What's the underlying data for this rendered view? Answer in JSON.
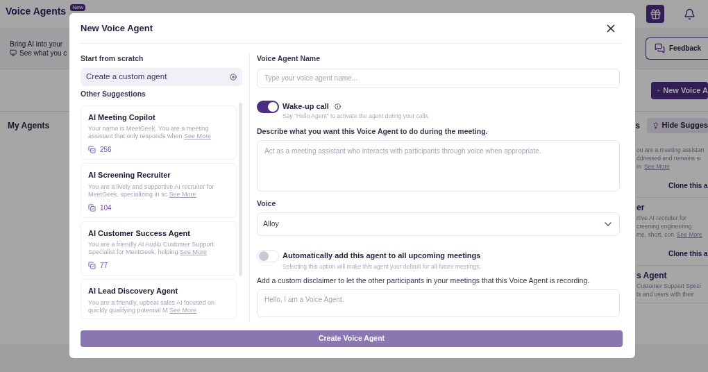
{
  "page": {
    "title": "Voice Agents",
    "badge": "New",
    "banner_lines": [
      "Bring AI into your",
      "See what you c"
    ],
    "feedback": "Feedback",
    "new_button": "New Voice A",
    "section_title": "My Agents",
    "section_tail": "s",
    "hide_button": "Hide Sugges",
    "cards": [
      {
        "lines": [
          "ou are a meeting assistan",
          "ddressed and remains si",
          "m"
        ],
        "see_more": "See More",
        "action": "Clone this a"
      },
      {
        "title": "er",
        "lines": [
          "rtive AI recruiter for",
          "creening engineering",
          "me, short, con"
        ],
        "see_more": "See More",
        "action": "Clone this a"
      },
      {
        "title": "s Agent",
        "lines": [
          "Customer Support Speci",
          "ts and users with their"
        ]
      }
    ]
  },
  "modal": {
    "title": "New Voice Agent",
    "scratch_label": "Start from scratch",
    "custom_button": "Create a custom agent",
    "suggestions_label": "Other Suggestions",
    "suggestions": [
      {
        "title": "AI Meeting Copilot",
        "description": "Your name is MeetGeek. You are a meeting assistant that only responds when",
        "see_more": "See More",
        "count": "256"
      },
      {
        "title": "AI Screening Recruiter",
        "description": "You are a lively and supportive AI recruiter for MeetGeek, specializing in sc",
        "see_more": "See More",
        "count": "104"
      },
      {
        "title": "AI Customer Success Agent",
        "description": "You are a friendly AI Audio Customer Support Specialist for MeetGeek, helping",
        "see_more": "See More",
        "count": "77"
      },
      {
        "title": "AI Lead Discovery Agent",
        "description": "You are a friendly, upbeat sales AI focused on quickly qualifying potential M",
        "see_more": "See More"
      }
    ],
    "name_label": "Voice Agent Name",
    "name_placeholder": "Type your voice agent name...",
    "wake": {
      "label": "Wake-up call",
      "hint": "Say \"Hello Agent\" to activate the agent during your calls.",
      "on": true
    },
    "describe_label": "Describe what you want this Voice Agent to do during the meeting.",
    "describe_placeholder": "Act as a meeting assistant who interacts with participants through voice when appropriate.",
    "voice_label": "Voice",
    "voice_value": "Alloy",
    "auto": {
      "label": "Automatically add this agent to all upcoming meetings",
      "hint": "Selecting this option will make this agent your default for all future meetings.",
      "on": false
    },
    "disclaimer_label": "Add a custom disclaimer to let the other participants in your meetings that this Voice Agent is recording.",
    "disclaimer_placeholder": "Hello, I am a Voice Agent.",
    "submit": "Create Voice Agent"
  }
}
